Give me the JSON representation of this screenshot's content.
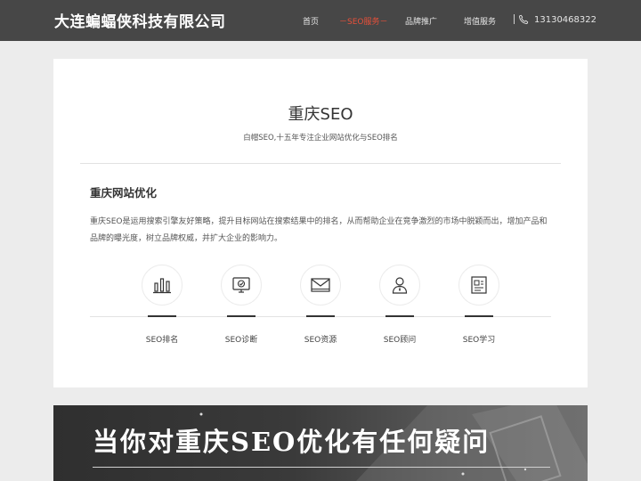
{
  "header": {
    "brand": "大连蝙蝠侠科技有限公司",
    "nav": [
      {
        "label": "首页",
        "active": false
      },
      {
        "label": "－SEO服务－",
        "active": true
      },
      {
        "label": "品牌推广",
        "active": false
      },
      {
        "label": "增值服务",
        "active": false
      }
    ],
    "phone": "13130468322",
    "icons": {
      "phone": "phone-icon"
    }
  },
  "main": {
    "title": "重庆SEO",
    "subtitle": "白帽SEO,十五年专注企业网站优化与SEO排名",
    "section_heading": "重庆网站优化",
    "section_body": "重庆SEO是运用搜索引擎友好策略，提升目标网站在搜索结果中的排名，从而帮助企业在竞争激烈的市场中脱颖而出，增加产品和品牌的曝光度，树立品牌权威，并扩大企业的影响力。",
    "features": [
      {
        "label": "SEO排名",
        "icon": "bar-chart-icon"
      },
      {
        "label": "SEO诊断",
        "icon": "monitor-check-icon"
      },
      {
        "label": "SEO资源",
        "icon": "mail-icon"
      },
      {
        "label": "SEO顾问",
        "icon": "consultant-icon"
      },
      {
        "label": "SEO学习",
        "icon": "document-icon"
      }
    ]
  },
  "banner": {
    "text": "当你对重庆SEO优化有任何疑问"
  },
  "colors": {
    "header_bg": "#474747",
    "accent": "#e8503a",
    "page_bg": "#ececec",
    "card_bg": "#ffffff"
  }
}
